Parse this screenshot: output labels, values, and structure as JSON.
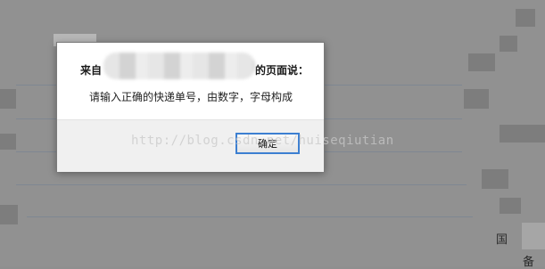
{
  "dialog": {
    "title_prefix": "来自",
    "title_suffix": "的页面说：",
    "message": "请输入正确的快递单号，由数字，字母构成",
    "ok_label": "确定"
  },
  "watermark": "http://blog.csdn.net/huiseqiutian",
  "background": {
    "edge_char_1": "国",
    "edge_char_2": "备"
  },
  "colors": {
    "overlay": "#919191",
    "dialog_bg": "#ffffff",
    "footer_bg": "#f0f0f0",
    "button_focus_border": "#3c7fd1"
  }
}
